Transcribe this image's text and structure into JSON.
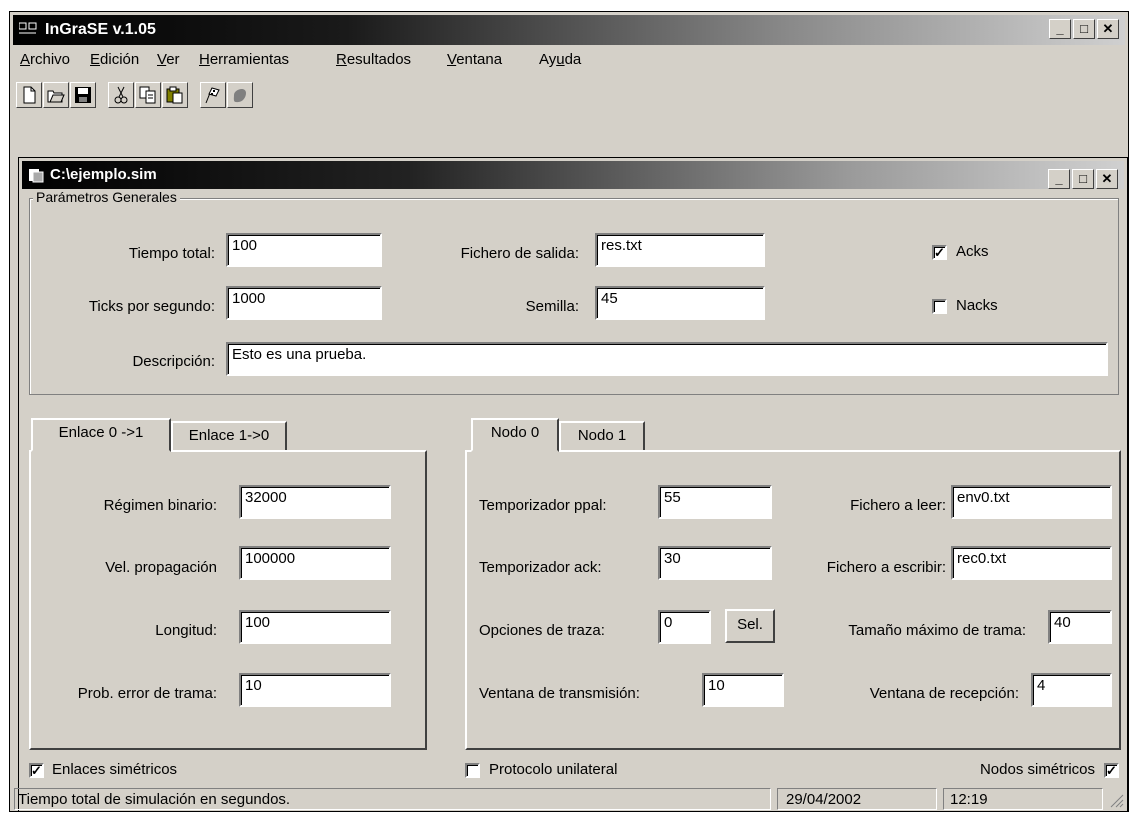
{
  "window": {
    "title": "InGraSE v.1.05"
  },
  "menu": [
    {
      "pre": "",
      "u": "A",
      "rest": "rchivo"
    },
    {
      "pre": "",
      "u": "E",
      "rest": "dición"
    },
    {
      "pre": "",
      "u": "V",
      "rest": "er"
    },
    {
      "pre": "",
      "u": "H",
      "rest": "erramientas"
    },
    {
      "pre": "",
      "u": "R",
      "rest": "esultados"
    },
    {
      "pre": "",
      "u": "V",
      "rest": "entana"
    },
    {
      "pre": "Ay",
      "u": "u",
      "rest": "da"
    }
  ],
  "toolbar": [
    "new-icon",
    "open-icon",
    "save-icon",
    "cut-icon",
    "copy-icon",
    "paste-icon",
    "flags-icon",
    "run-icon"
  ],
  "document": {
    "title": "C:\\ejemplo.sim"
  },
  "general": {
    "legend": "Parámetros Generales",
    "tiempo_total": {
      "label": "Tiempo total:",
      "value": "100"
    },
    "ticks": {
      "label": "Ticks por segundo:",
      "value": "1000"
    },
    "fichero_salida": {
      "label": "Fichero de salida:",
      "value": "res.txt"
    },
    "semilla": {
      "label": "Semilla:",
      "value": "45"
    },
    "acks": {
      "label": "Acks",
      "checked": true
    },
    "nacks": {
      "label": "Nacks",
      "checked": false
    },
    "descripcion": {
      "label": "Descripción:",
      "value": "Esto es una prueba."
    }
  },
  "link_tabs": [
    "Enlace 0 ->1",
    "Enlace 1->0"
  ],
  "link": {
    "regimen": {
      "label": "Régimen binario:",
      "value": "32000"
    },
    "vel": {
      "label": "Vel. propagación",
      "value": "100000"
    },
    "longitud": {
      "label": "Longitud:",
      "value": "100"
    },
    "prob": {
      "label": "Prob. error de trama:",
      "value": "10"
    }
  },
  "node_tabs": [
    "Nodo 0",
    "Nodo 1"
  ],
  "node": {
    "temp_ppal": {
      "label": "Temporizador ppal:",
      "value": "55"
    },
    "temp_ack": {
      "label": "Temporizador ack:",
      "value": "30"
    },
    "opciones": {
      "label": "Opciones de traza:",
      "value": "0"
    },
    "sel_button": "Sel.",
    "vent_tx": {
      "label": "Ventana de transmisión:",
      "value": "10"
    },
    "fich_leer": {
      "label": "Fichero a leer:",
      "value": "env0.txt"
    },
    "fich_escribir": {
      "label": "Fichero a escribir:",
      "value": "rec0.txt"
    },
    "tam_trama": {
      "label": "Tamaño máximo de trama:",
      "value": "40"
    },
    "vent_rx": {
      "label": "Ventana de recepción:",
      "value": "4"
    }
  },
  "options": {
    "enlaces_sim": {
      "label": "Enlaces simétricos",
      "checked": true
    },
    "protocolo": {
      "label": "Protocolo unilateral",
      "checked": false
    },
    "nodos_sim": {
      "label": "Nodos simétricos",
      "checked": true
    }
  },
  "status": {
    "message": "Tiempo total de simulación en segundos.",
    "date": "29/04/2002",
    "time": "12:19"
  }
}
